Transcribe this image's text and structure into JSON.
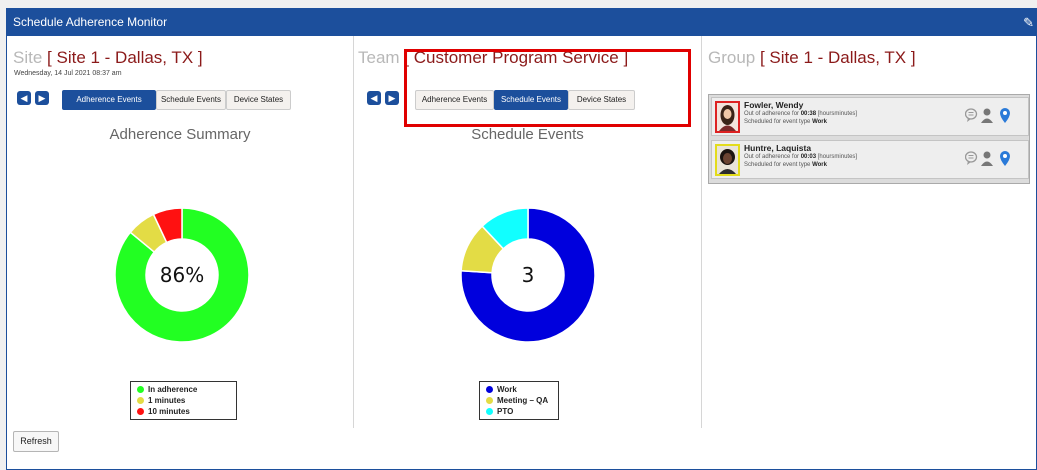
{
  "window": {
    "title": "Schedule Adherence Monitor"
  },
  "site": {
    "label": "Site",
    "value": "[ Site 1 - Dallas, TX ]",
    "date": "Wednesday, 14 Jul 2021 08:37 am",
    "tabs": [
      "Adherence Events",
      "Schedule Events",
      "Device States"
    ],
    "active_tab": "Adherence Events",
    "chart_title": "Adherence Summary",
    "center_value": "86%"
  },
  "team": {
    "label": "Team",
    "value": "[ Customer Program Service ]",
    "tabs": [
      "Adherence Events",
      "Schedule Events",
      "Device States"
    ],
    "active_tab": "Schedule Events",
    "chart_title": "Schedule Events",
    "center_value": "3"
  },
  "group": {
    "label": "Group",
    "value": "[ Site 1 - Dallas, TX ]",
    "agents": [
      {
        "name": "Fowler, Wendy",
        "line1_prefix": "Out of adherence for",
        "duration": "00:38",
        "line1_suffix": "[hoursminutes]",
        "line2_prefix": "Scheduled for event type",
        "event_type": "Work",
        "border_color": "#dd2222"
      },
      {
        "name": "Huntre, Laquista",
        "line1_prefix": "Out of adherence for",
        "duration": "00:03",
        "line1_suffix": "[hoursminutes]",
        "line2_prefix": "Scheduled for event type",
        "event_type": "Work",
        "border_color": "#e3dc1c"
      }
    ]
  },
  "refresh_label": "Refresh",
  "colors": {
    "primary": "#1c4f9c",
    "title_accent": "#8b1a1a",
    "highlight": "#e00000"
  },
  "chart_data": [
    {
      "type": "pie",
      "title": "Adherence Summary",
      "categories": [
        "In adherence",
        "1 minutes",
        "10 minutes"
      ],
      "values": [
        86,
        7,
        7
      ],
      "colors": [
        "#22ff22",
        "#e3dc45",
        "#ff1111"
      ],
      "center_label": "86%",
      "legend": "bottom"
    },
    {
      "type": "pie",
      "title": "Schedule Events",
      "categories": [
        "Work",
        "Meeting – QA",
        "PTO"
      ],
      "values": [
        76,
        12,
        12
      ],
      "colors": [
        "#0000dd",
        "#e3dc45",
        "#11ffff"
      ],
      "center_label": "3",
      "legend": "bottom"
    }
  ]
}
